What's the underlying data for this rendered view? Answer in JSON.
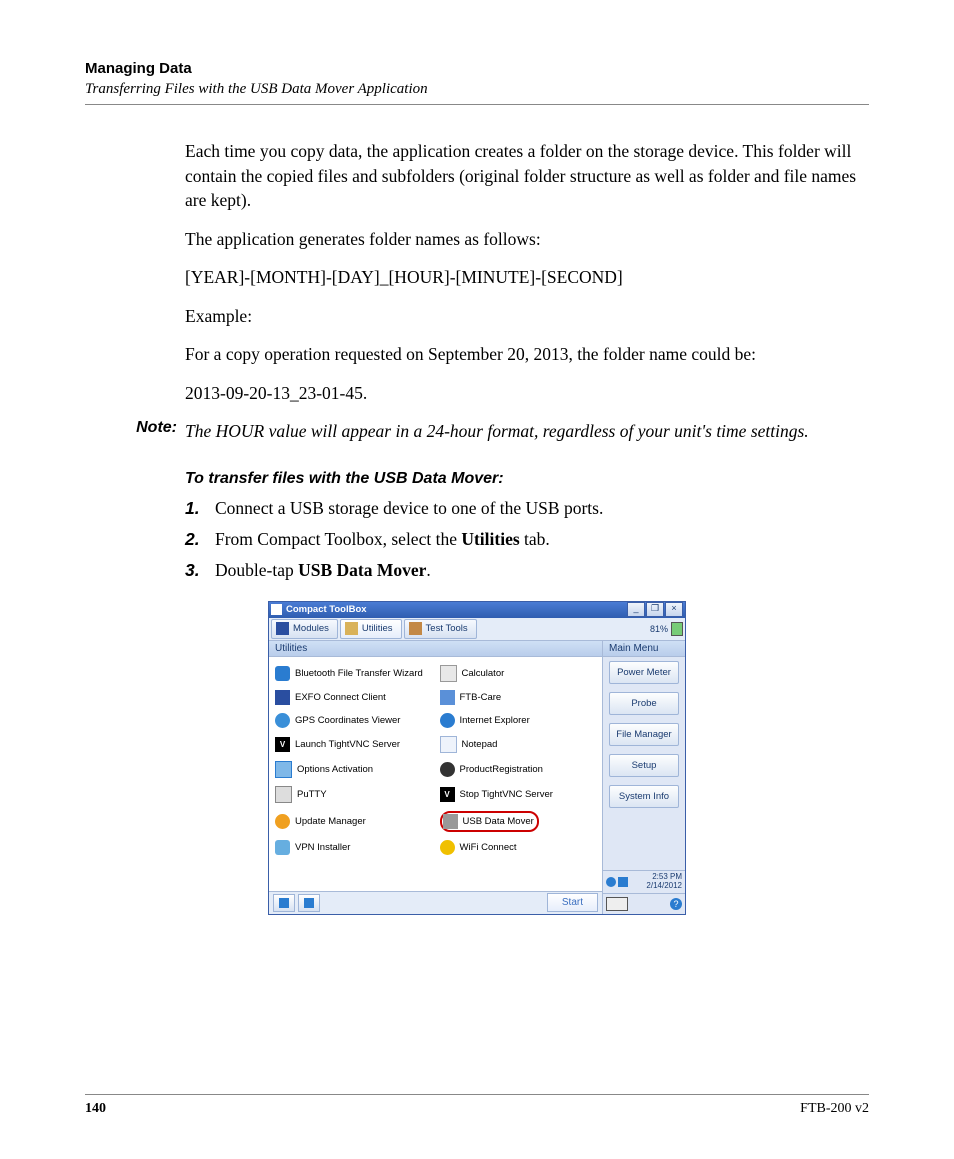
{
  "header": {
    "title": "Managing Data",
    "subtitle": "Transferring Files with the USB Data Mover Application"
  },
  "paragraphs": {
    "p1": "Each time you copy data, the application creates a folder on the storage device. This folder will contain the copied files and subfolders (original folder structure as well as folder and file names are kept).",
    "p2": "The application generates folder names as follows:",
    "p3": "[YEAR]-[MONTH]-[DAY]_[HOUR]-[MINUTE]-[SECOND]",
    "p4": "Example:",
    "p5": "For a copy operation requested on September 20, 2013, the folder name could be:",
    "p6": "2013-09-20-13_23-01-45."
  },
  "note": {
    "label": "Note:",
    "body": "The HOUR value will appear in a 24-hour format, regardless of your unit's time settings."
  },
  "procedure": {
    "title": "To transfer files with the USB Data Mover:",
    "steps": [
      {
        "num": "1.",
        "pre": "Connect a USB storage device to one of the USB ports."
      },
      {
        "num": "2.",
        "pre": "From Compact Toolbox, select the ",
        "bold": "Utilities",
        "post": " tab."
      },
      {
        "num": "3.",
        "pre": "Double-tap ",
        "bold": "USB Data Mover",
        "post": "."
      }
    ]
  },
  "screenshot": {
    "window_title": "Compact ToolBox",
    "win_buttons": {
      "min": "_",
      "max": "❐",
      "close": "×"
    },
    "tabs": {
      "modules": "Modules",
      "utilities": "Utilities",
      "test_tools": "Test Tools"
    },
    "battery": "81%",
    "panel_title": "Utilities",
    "side_panel_title": "Main Menu",
    "utilities_left": [
      "Bluetooth File Transfer Wizard",
      "EXFO Connect Client",
      "GPS Coordinates Viewer",
      "Launch TightVNC Server",
      "Options Activation",
      "PuTTY",
      "Update Manager",
      "VPN Installer"
    ],
    "utilities_right": [
      "Calculator",
      "FTB-Care",
      "Internet Explorer",
      "Notepad",
      "ProductRegistration",
      "Stop TightVNC Server",
      "USB Data Mover",
      "WiFi Connect"
    ],
    "side_buttons": [
      "Power Meter",
      "Probe",
      "File Manager",
      "Setup",
      "System Info"
    ],
    "start": "Start",
    "clock": {
      "time": "2:53 PM",
      "date": "2/14/2012"
    }
  },
  "footer": {
    "page": "140",
    "doc": "FTB-200 v2"
  }
}
